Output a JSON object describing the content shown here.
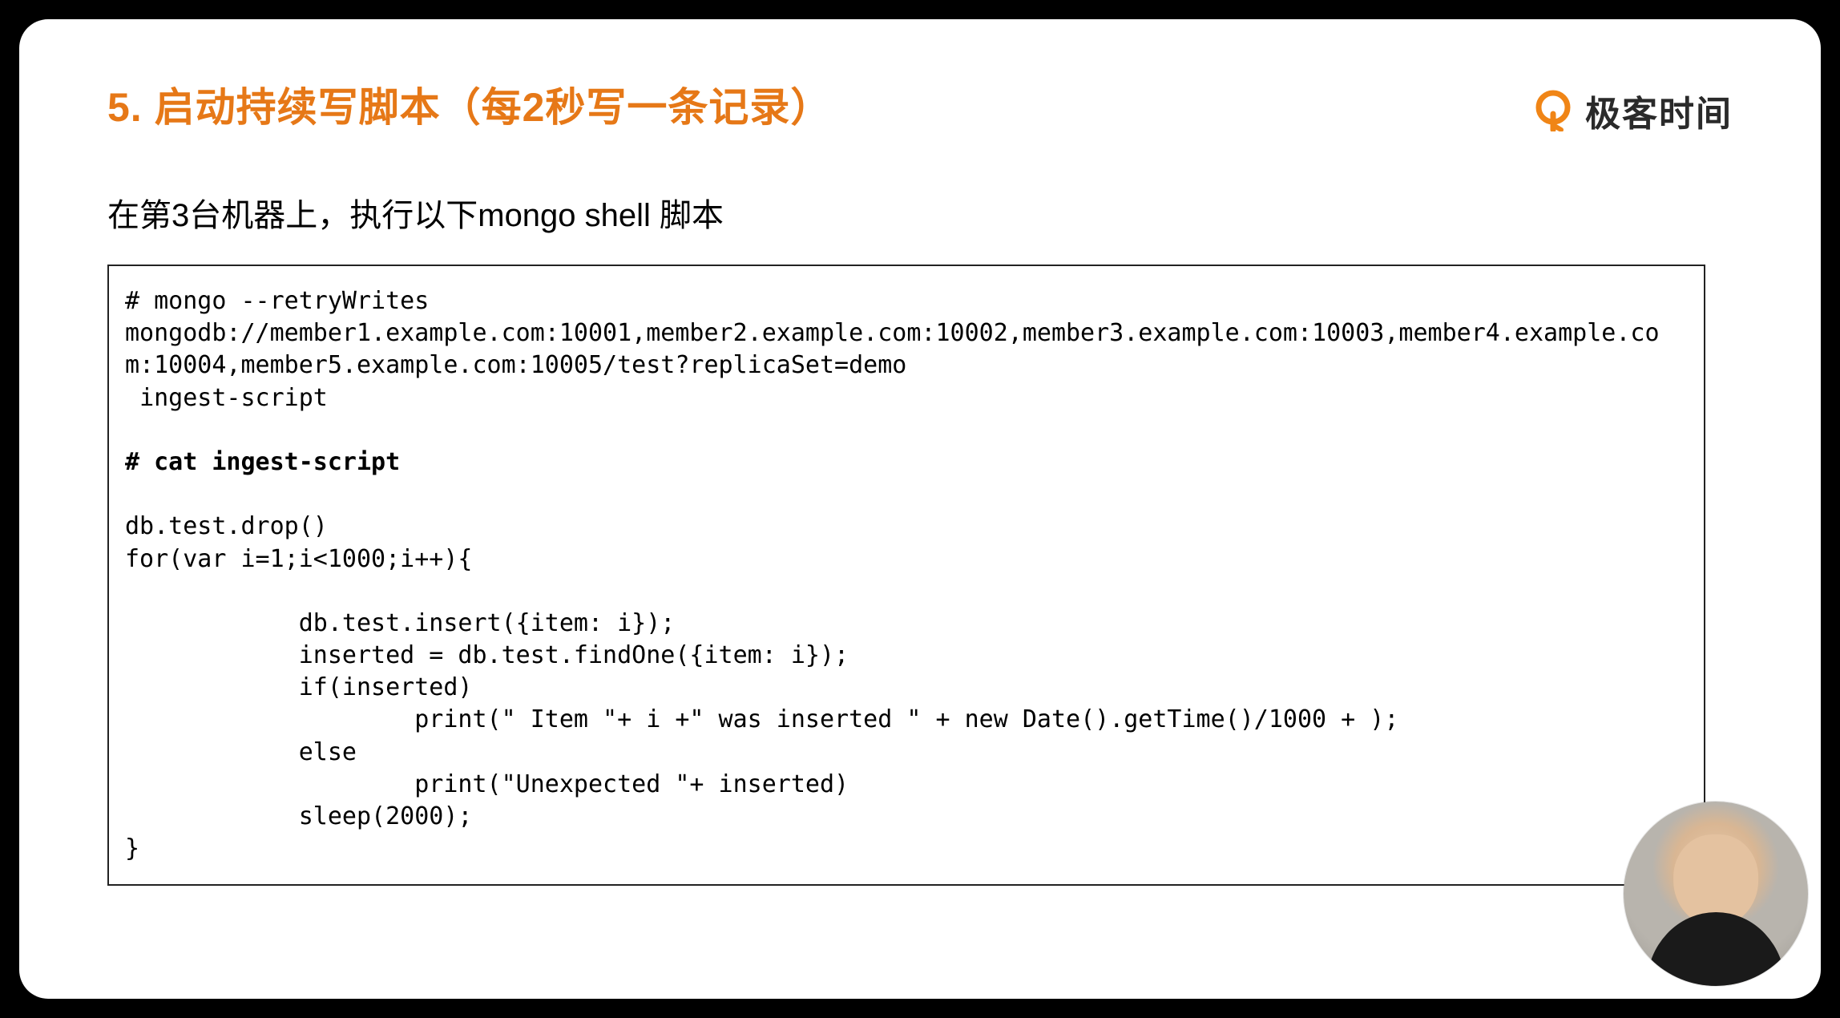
{
  "title": "5. 启动持续写脚本（每2秒写一条记录）",
  "subtitle": "在第3台机器上，执行以下mongo shell 脚本",
  "logo_text": "极客时间",
  "code": {
    "line1": "# mongo --retryWrites",
    "line2": "mongodb://member1.example.com:10001,member2.example.com:10002,member3.example.com:10003,member4.example.com:10004,member5.example.com:10005/test?replicaSet=demo",
    "line3": " ingest-script",
    "blank1": "",
    "line4": "# cat ingest-script",
    "blank2": "",
    "line5": "db.test.drop()",
    "line6": "for(var i=1;i<1000;i++){",
    "blank3": "",
    "line7": "            db.test.insert({item: i});",
    "line8": "            inserted = db.test.findOne({item: i});",
    "line9": "            if(inserted)",
    "line10": "                    print(\" Item \"+ i +\" was inserted \" + new Date().getTime()/1000 + );",
    "line11": "            else",
    "line12": "                    print(\"Unexpected \"+ inserted)",
    "line13": "            sleep(2000);",
    "line14": "}"
  }
}
